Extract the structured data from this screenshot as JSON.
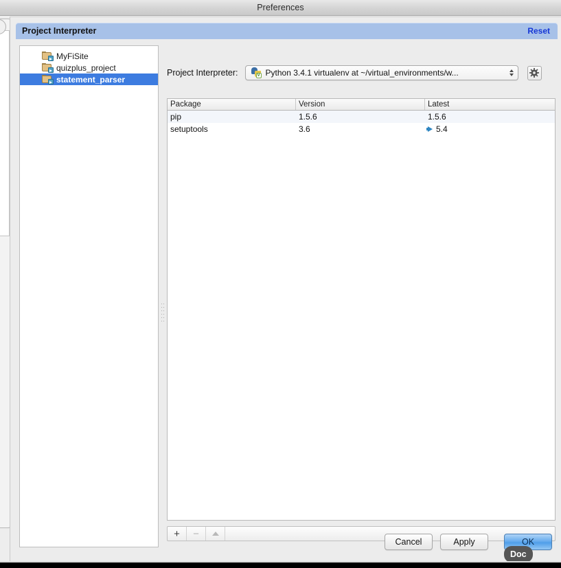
{
  "window": {
    "title": "Preferences"
  },
  "header": {
    "title": "Project Interpreter",
    "reset_label": "Reset"
  },
  "sidebar": {
    "items": [
      {
        "label": "MyFiSite",
        "icon": "folder-icon",
        "selected": false
      },
      {
        "label": "quizplus_project",
        "icon": "folder-icon",
        "selected": false
      },
      {
        "label": "statement_parser",
        "icon": "folder-icon",
        "selected": true
      }
    ]
  },
  "interpreter": {
    "label": "Project Interpreter:",
    "selected": "Python 3.4.1 virtualenv at ~/virtual_environments/w...",
    "icon": "python-virtualenv-icon",
    "settings_icon": "gear-icon"
  },
  "packages_table": {
    "columns": [
      "Package",
      "Version",
      "Latest"
    ],
    "rows": [
      {
        "package": "pip",
        "version": "1.5.6",
        "latest": "1.5.6",
        "upgradable": false
      },
      {
        "package": "setuptools",
        "version": "3.6",
        "latest": "5.4",
        "upgradable": true
      }
    ]
  },
  "mini_toolbar": {
    "add_label": "+",
    "remove_label": "−",
    "upgrade_icon": "triangle-up-icon"
  },
  "footer": {
    "cancel_label": "Cancel",
    "apply_label": "Apply",
    "ok_label": "OK"
  },
  "tooltip": {
    "text": "Doc"
  },
  "colors": {
    "header_band": "#a7c1e8",
    "reset_link": "#1536d6",
    "selection": "#3d7ce0",
    "ok_button": "#4f9ee9",
    "upgrade_arrow": "#2f86c2",
    "folder": "#e3c184"
  }
}
